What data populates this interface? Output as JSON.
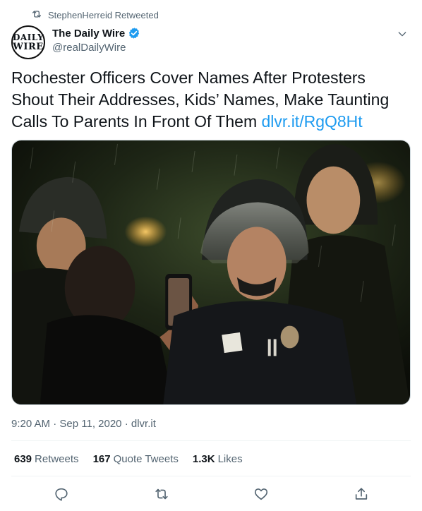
{
  "retweet": {
    "icon": "retweet-icon",
    "text": "StephenHerreid Retweeted"
  },
  "author": {
    "name": "The Daily Wire",
    "handle": "@realDailyWire",
    "avatar_line1": "DAILY",
    "avatar_line2": "WIRE",
    "verified_icon": "verified-badge-icon",
    "verified_color": "#1d9bf0"
  },
  "tweet": {
    "text": "Rochester Officers Cover Names After Protesters Shout Their Addresses, Kids’ Names, Make Taunting Calls To Parents In Front Of Them ",
    "link": "dlvr.it/RgQ8Ht",
    "link_color": "#1d9bf0",
    "image_alt": "Police officers in riot helmets at night in the rain; a protester holds up a phone"
  },
  "meta": {
    "time": "9:20 AM",
    "sep1": "·",
    "date": "Sep 11, 2020",
    "sep2": "·",
    "source": "dlvr.it"
  },
  "stats": {
    "retweets_count": "639",
    "retweets_label": "Retweets",
    "quotes_count": "167",
    "quotes_label": "Quote Tweets",
    "likes_count": "1.3K",
    "likes_label": "Likes"
  },
  "actions": [
    "reply-icon",
    "retweet-icon",
    "like-icon",
    "share-icon"
  ]
}
